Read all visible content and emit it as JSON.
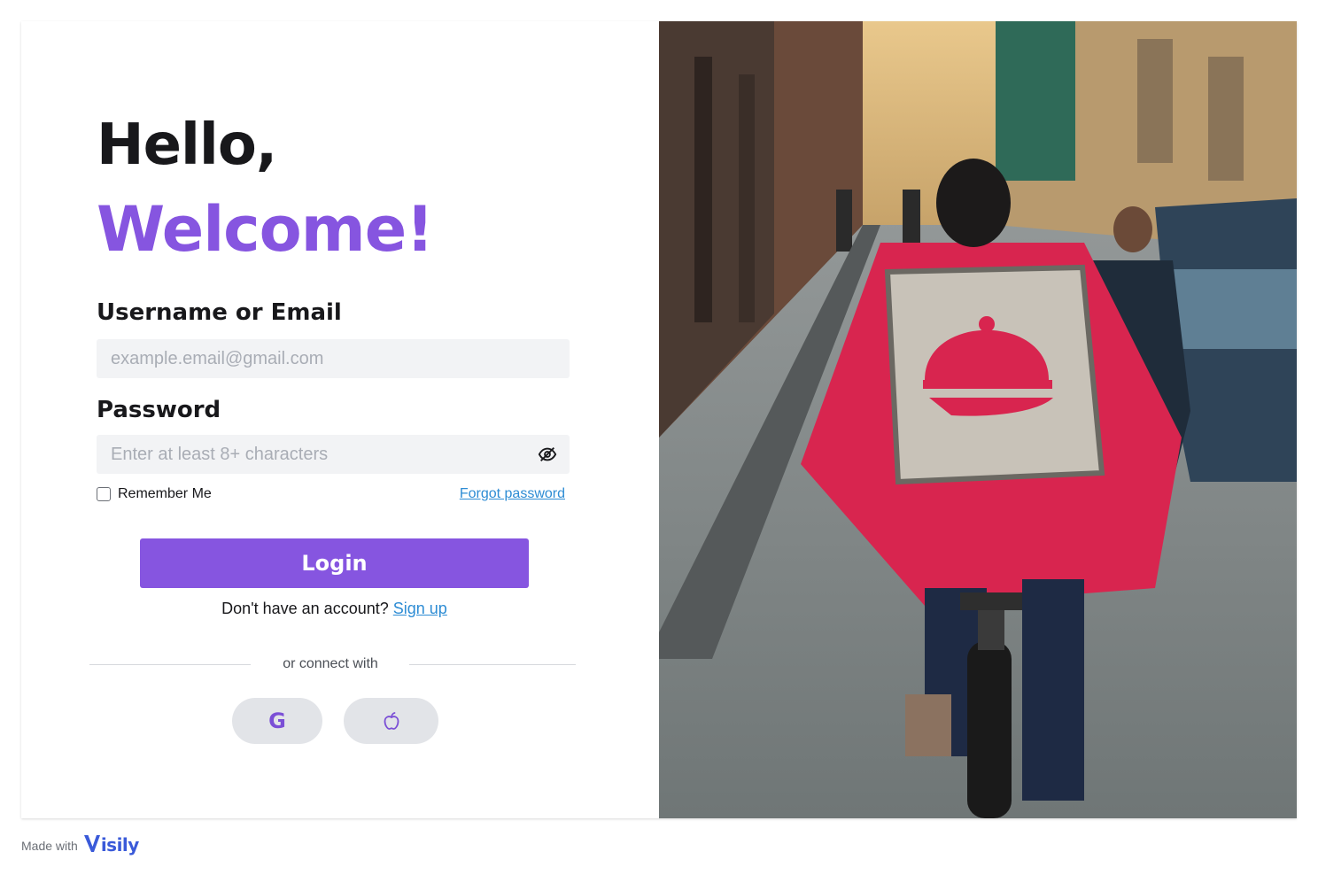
{
  "greeting": {
    "hello": "Hello,",
    "welcome": "Welcome!"
  },
  "form": {
    "username_label": "Username or Email",
    "username_placeholder": "example.email@gmail.com",
    "username_value": "",
    "password_label": "Password",
    "password_placeholder": "Enter at least 8+ characters",
    "password_value": "",
    "remember_label": "Remember Me",
    "remember_checked": false,
    "forgot_label": "Forgot password",
    "login_label": "Login",
    "signup_prompt": "Don't have an account?",
    "signup_link": "Sign up",
    "connect_text": "or connect with"
  },
  "social": [
    {
      "name": "google",
      "icon": "google-icon",
      "glyph": "G"
    },
    {
      "name": "apple",
      "icon": "apple-icon"
    }
  ],
  "footer": {
    "made_with": "Made with",
    "brand": "isily"
  },
  "colors": {
    "accent": "#8655e0",
    "link": "#2d8cd4",
    "field_bg": "#f2f3f5",
    "social_bg": "#e2e4e8"
  },
  "photo": {
    "subject": "delivery-rider-photo"
  }
}
